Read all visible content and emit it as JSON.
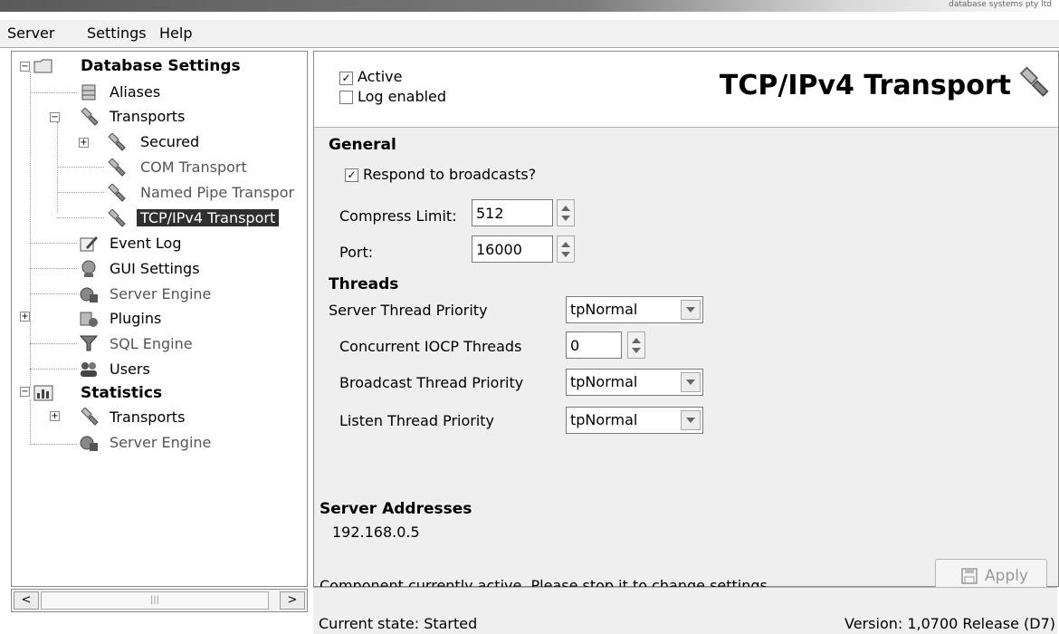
{
  "titlebar": {
    "brand": "database systems pty ltd"
  },
  "menu": [
    "Server",
    "Settings",
    "Help"
  ],
  "tree": {
    "database_settings": "Database Settings",
    "aliases": "Aliases",
    "transports": "Transports",
    "secured": "Secured",
    "com_transport": "COM Transport",
    "named_pipe": "Named Pipe Transpor",
    "tcp_transport": "TCP/IPv4 Transport",
    "event_log": "Event Log",
    "gui_settings": "GUI Settings",
    "server_engine": "Server Engine",
    "plugins": "Plugins",
    "sql_engine": "SQL Engine",
    "users": "Users",
    "statistics": "Statistics",
    "stat_transports": "Transports",
    "stat_server_engine": "Server Engine"
  },
  "panel": {
    "active_label": "Active",
    "log_label": "Log enabled",
    "title": "TCP/IPv4 Transport",
    "general_heading": "General",
    "respond_label": "Respond to broadcasts?",
    "compress_label": "Compress Limit:",
    "compress_value": "512",
    "port_label": "Port:",
    "port_value": "16000",
    "threads_heading": "Threads",
    "server_thread_label": "Server Thread Priority",
    "server_thread_value": "tpNormal",
    "iocp_label": "Concurrent IOCP Threads",
    "iocp_value": "0",
    "broadcast_thread_label": "Broadcast Thread Priority",
    "broadcast_thread_value": "tpNormal",
    "listen_thread_label": "Listen Thread Priority",
    "listen_thread_value": "tpNormal",
    "addresses_heading": "Server Addresses",
    "address": "192.168.0.5",
    "notice": "Component currently active. Please stop it to change settings.",
    "apply_label": "Apply"
  },
  "status": {
    "state": "Current state: Started",
    "version": "Version: 1,0700 Release (D7)"
  }
}
